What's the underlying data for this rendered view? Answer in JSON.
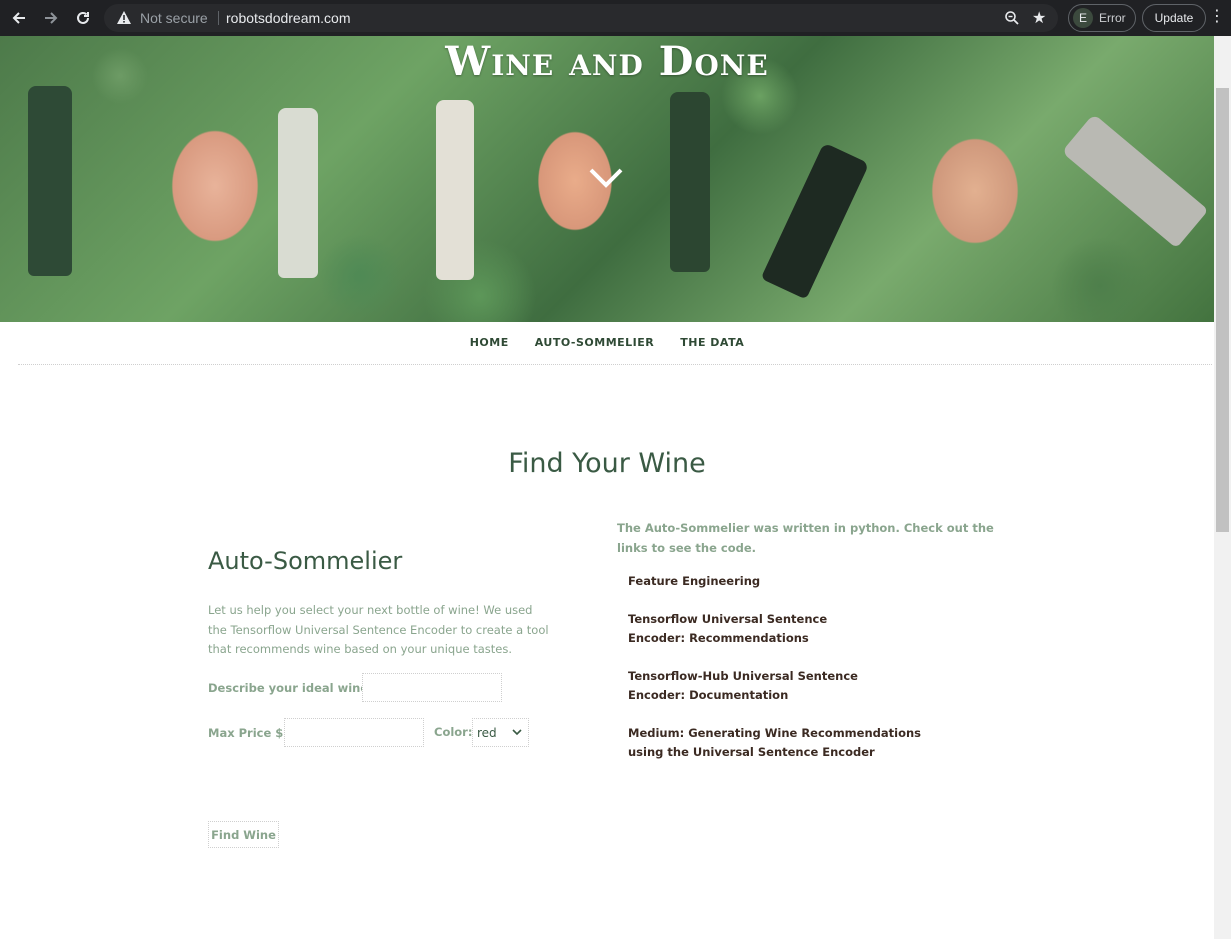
{
  "browser": {
    "security_label": "Not secure",
    "url": "robotsdodream.com",
    "profile_initial": "E",
    "profile_status": "Error",
    "update_label": "Update"
  },
  "hero": {
    "title": "Wine and Done"
  },
  "nav": {
    "items": [
      "HOME",
      "AUTO-SOMMELIER",
      "THE DATA"
    ]
  },
  "page": {
    "title": "Find Your Wine"
  },
  "sommelier": {
    "heading": "Auto-Sommelier",
    "intro": "Let us help you select your next bottle of wine! We used the Tensorflow Universal Sentence Encoder to create a tool that recommends wine based on your unique tastes.",
    "describe_label": "Describe your ideal wine:",
    "describe_value": "",
    "price_label": "Max Price $:",
    "price_value": "",
    "color_label": "Color:",
    "color_selected": "red",
    "submit_label": "Find Wine"
  },
  "resources": {
    "intro": "The Auto-Sommelier was written in python. Check out the links to see the code.",
    "links": [
      "Feature Engineering",
      "Tensorflow Universal Sentence Encoder: Recommendations",
      "Tensorflow-Hub Universal Sentence Encoder: Documentation",
      "Medium: Generating Wine Recommendations using the Universal Sentence Encoder"
    ]
  },
  "colors": {
    "heading": "#3a5a44",
    "muted": "#8aa58e",
    "link": "#3b2a22",
    "chrome": "#202124"
  }
}
